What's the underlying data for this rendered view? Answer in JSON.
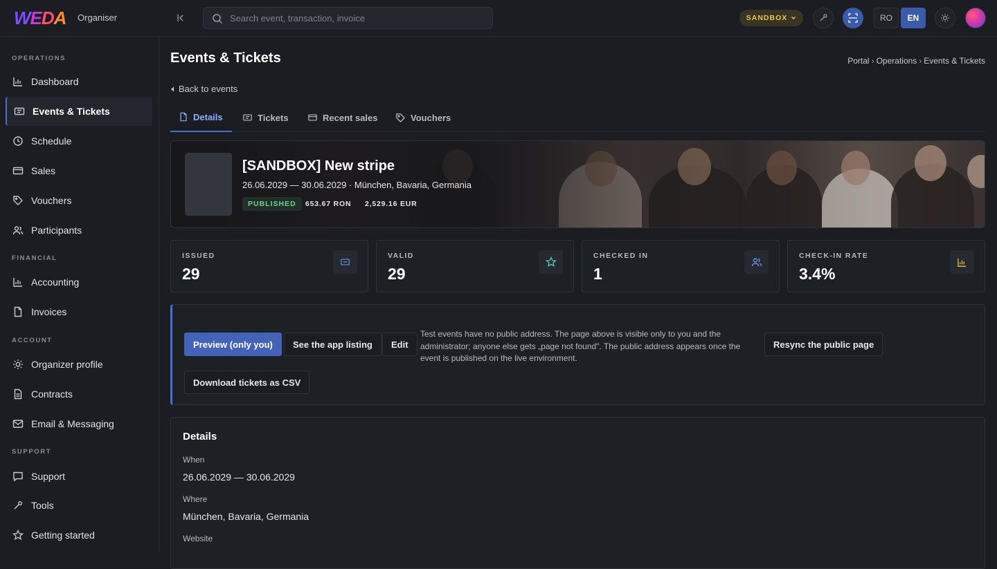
{
  "brand": {
    "logo_text": "WEDA",
    "org_label": "Organiser"
  },
  "search": {
    "placeholder": "Search event, transaction, invoice"
  },
  "topbar": {
    "env_label": "SANDBOX",
    "languages": [
      "RO",
      "EN"
    ],
    "active_language": "EN"
  },
  "sidebar": {
    "sections": [
      {
        "label": "OPERATIONS",
        "items": [
          {
            "label": "Dashboard",
            "icon": "bar-chart-icon"
          },
          {
            "label": "Events & Tickets",
            "icon": "ticket-icon",
            "active": true
          },
          {
            "label": "Schedule",
            "icon": "clock-icon"
          },
          {
            "label": "Sales",
            "icon": "card-icon"
          },
          {
            "label": "Vouchers",
            "icon": "tag-icon"
          },
          {
            "label": "Participants",
            "icon": "users-icon"
          }
        ]
      },
      {
        "label": "FINANCIAL",
        "items": [
          {
            "label": "Accounting",
            "icon": "bar-chart-icon"
          },
          {
            "label": "Invoices",
            "icon": "document-icon"
          }
        ]
      },
      {
        "label": "ACCOUNT",
        "items": [
          {
            "label": "Organizer profile",
            "icon": "sun-icon"
          },
          {
            "label": "Contracts",
            "icon": "document-icon"
          },
          {
            "label": "Email & Messaging",
            "icon": "mail-icon"
          }
        ]
      },
      {
        "label": "SUPPORT",
        "items": [
          {
            "label": "Support",
            "icon": "chat-icon"
          },
          {
            "label": "Tools",
            "icon": "wrench-icon"
          },
          {
            "label": "Getting started",
            "icon": "star-icon"
          }
        ]
      }
    ]
  },
  "page": {
    "title": "Events & Tickets",
    "breadcrumb": [
      "Portal",
      "Operations",
      "Events & Tickets"
    ],
    "back_label": "Back to events"
  },
  "tabs": [
    {
      "label": "Details",
      "icon": "document-icon",
      "active": true
    },
    {
      "label": "Tickets",
      "icon": "ticket-icon"
    },
    {
      "label": "Recent sales",
      "icon": "card-icon"
    },
    {
      "label": "Vouchers",
      "icon": "tag-icon"
    }
  ],
  "event": {
    "title": "[SANDBOX] New stripe",
    "subtitle": "26.06.2029 — 30.06.2029 · München, Bavaria, Germania",
    "status": "PUBLISHED",
    "revenue_ron": "653.67 RON",
    "revenue_eur": "2,529.16 EUR"
  },
  "stats": [
    {
      "label": "ISSUED",
      "value": "29",
      "icon": "ticket-icon"
    },
    {
      "label": "VALID",
      "value": "29",
      "icon": "star-icon"
    },
    {
      "label": "CHECKED IN",
      "value": "1",
      "icon": "users-icon"
    },
    {
      "label": "CHECK-IN RATE",
      "value": "3.4%",
      "icon": "bar-chart-icon"
    }
  ],
  "actions": {
    "preview": "Preview (only you)",
    "app_listing": "See the app listing",
    "edit": "Edit",
    "download_csv": "Download tickets as CSV",
    "resync": "Resync the public page",
    "note": "Test events have no public address. The page above is visible only to you and the administrator; anyone else gets „page not found\". The public address appears once the event is published on the live environment."
  },
  "details": {
    "heading": "Details",
    "when_label": "When",
    "when_value": "26.06.2029 — 30.06.2029",
    "where_label": "Where",
    "where_value": "München, Bavaria, Germania",
    "website_label": "Website"
  },
  "colors": {
    "accent": "#4462b8",
    "background": "#1b1d22",
    "sandbox": "#e8c45a",
    "published": "#6fcf97"
  }
}
